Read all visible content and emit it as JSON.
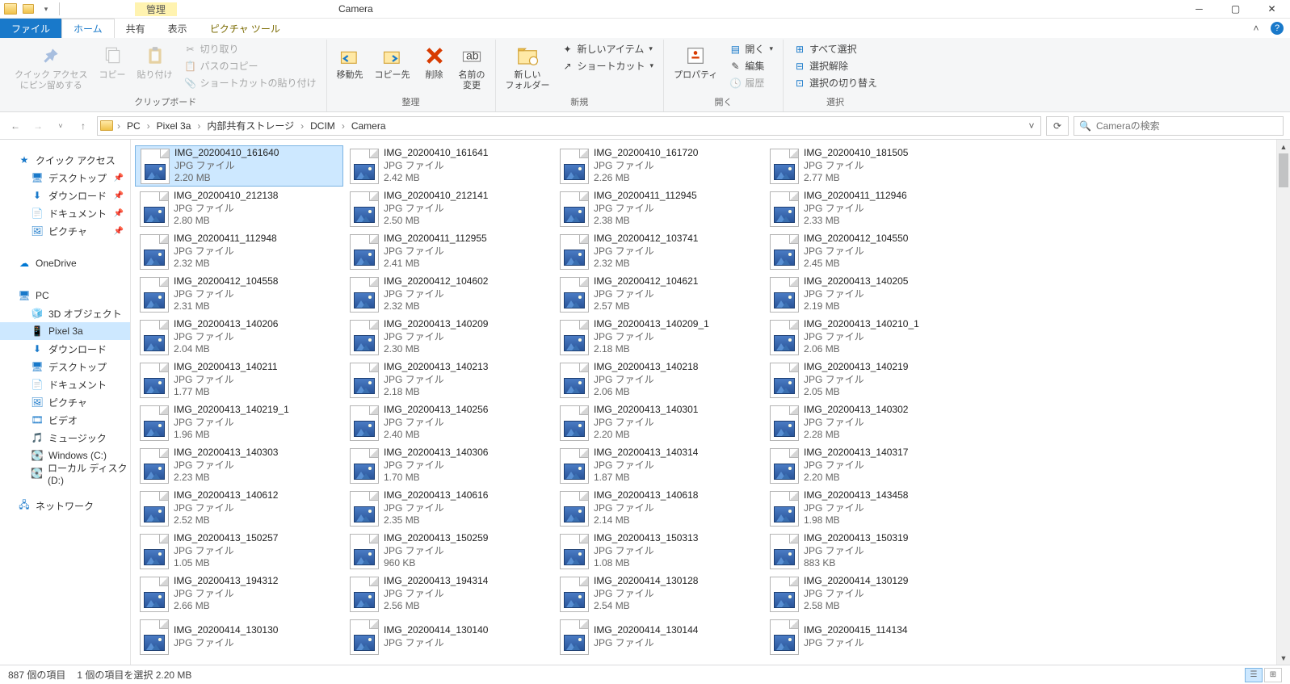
{
  "window": {
    "title": "Camera"
  },
  "ribbon_context": {
    "label": "管理",
    "tab": "ピクチャ ツール"
  },
  "tabs": {
    "file": "ファイル",
    "home": "ホーム",
    "share": "共有",
    "view": "表示"
  },
  "ribbon": {
    "clipboard": {
      "label": "クリップボード",
      "pin": "クイック アクセス\nにピン留めする",
      "copy": "コピー",
      "paste": "貼り付け",
      "cut": "切り取り",
      "copy_path": "パスのコピー",
      "paste_shortcut": "ショートカットの貼り付け"
    },
    "organize": {
      "label": "整理",
      "move_to": "移動先",
      "copy_to": "コピー先",
      "delete": "削除",
      "rename": "名前の\n変更"
    },
    "new": {
      "label": "新規",
      "new_folder": "新しい\nフォルダー",
      "new_item": "新しいアイテム",
      "shortcut": "ショートカット"
    },
    "open": {
      "label": "開く",
      "properties": "プロパティ",
      "open": "開く",
      "edit": "編集",
      "history": "履歴"
    },
    "select": {
      "label": "選択",
      "select_all": "すべて選択",
      "select_none": "選択解除",
      "invert": "選択の切り替え"
    }
  },
  "breadcrumbs": [
    "PC",
    "Pixel 3a",
    "内部共有ストレージ",
    "DCIM",
    "Camera"
  ],
  "search": {
    "placeholder": "Cameraの検索"
  },
  "nav": {
    "quick_access": "クイック アクセス",
    "desktop": "デスクトップ",
    "downloads": "ダウンロード",
    "documents": "ドキュメント",
    "pictures": "ピクチャ",
    "onedrive": "OneDrive",
    "pc": "PC",
    "objects3d": "3D オブジェクト",
    "pixel3a": "Pixel 3a",
    "downloads2": "ダウンロード",
    "desktop2": "デスクトップ",
    "documents2": "ドキュメント",
    "pictures2": "ピクチャ",
    "videos": "ビデオ",
    "music": "ミュージック",
    "windows_c": "Windows (C:)",
    "local_d": "ローカル ディスク (D:)",
    "network": "ネットワーク"
  },
  "file_type_label": "JPG ファイル",
  "files": [
    {
      "name": "IMG_20200410_161640",
      "size": "2.20 MB",
      "sel": true
    },
    {
      "name": "IMG_20200410_161641",
      "size": "2.42 MB"
    },
    {
      "name": "IMG_20200410_161720",
      "size": "2.26 MB"
    },
    {
      "name": "IMG_20200410_181505",
      "size": "2.77 MB"
    },
    {
      "name": "IMG_20200410_212138",
      "size": "2.80 MB"
    },
    {
      "name": "IMG_20200410_212141",
      "size": "2.50 MB"
    },
    {
      "name": "IMG_20200411_112945",
      "size": "2.38 MB"
    },
    {
      "name": "IMG_20200411_112946",
      "size": "2.33 MB"
    },
    {
      "name": "IMG_20200411_112948",
      "size": "2.32 MB"
    },
    {
      "name": "IMG_20200411_112955",
      "size": "2.41 MB"
    },
    {
      "name": "IMG_20200412_103741",
      "size": "2.32 MB"
    },
    {
      "name": "IMG_20200412_104550",
      "size": "2.45 MB"
    },
    {
      "name": "IMG_20200412_104558",
      "size": "2.31 MB"
    },
    {
      "name": "IMG_20200412_104602",
      "size": "2.32 MB"
    },
    {
      "name": "IMG_20200412_104621",
      "size": "2.57 MB"
    },
    {
      "name": "IMG_20200413_140205",
      "size": "2.19 MB"
    },
    {
      "name": "IMG_20200413_140206",
      "size": "2.04 MB"
    },
    {
      "name": "IMG_20200413_140209",
      "size": "2.30 MB"
    },
    {
      "name": "IMG_20200413_140209_1",
      "size": "2.18 MB"
    },
    {
      "name": "IMG_20200413_140210_1",
      "size": "2.06 MB"
    },
    {
      "name": "IMG_20200413_140211",
      "size": "1.77 MB"
    },
    {
      "name": "IMG_20200413_140213",
      "size": "2.18 MB"
    },
    {
      "name": "IMG_20200413_140218",
      "size": "2.06 MB"
    },
    {
      "name": "IMG_20200413_140219",
      "size": "2.05 MB"
    },
    {
      "name": "IMG_20200413_140219_1",
      "size": "1.96 MB"
    },
    {
      "name": "IMG_20200413_140256",
      "size": "2.40 MB"
    },
    {
      "name": "IMG_20200413_140301",
      "size": "2.20 MB"
    },
    {
      "name": "IMG_20200413_140302",
      "size": "2.28 MB"
    },
    {
      "name": "IMG_20200413_140303",
      "size": "2.23 MB"
    },
    {
      "name": "IMG_20200413_140306",
      "size": "1.70 MB"
    },
    {
      "name": "IMG_20200413_140314",
      "size": "1.87 MB"
    },
    {
      "name": "IMG_20200413_140317",
      "size": "2.20 MB"
    },
    {
      "name": "IMG_20200413_140612",
      "size": "2.52 MB"
    },
    {
      "name": "IMG_20200413_140616",
      "size": "2.35 MB"
    },
    {
      "name": "IMG_20200413_140618",
      "size": "2.14 MB"
    },
    {
      "name": "IMG_20200413_143458",
      "size": "1.98 MB"
    },
    {
      "name": "IMG_20200413_150257",
      "size": "1.05 MB"
    },
    {
      "name": "IMG_20200413_150259",
      "size": "960 KB"
    },
    {
      "name": "IMG_20200413_150313",
      "size": "1.08 MB"
    },
    {
      "name": "IMG_20200413_150319",
      "size": "883 KB"
    },
    {
      "name": "IMG_20200413_194312",
      "size": "2.66 MB"
    },
    {
      "name": "IMG_20200413_194314",
      "size": "2.56 MB"
    },
    {
      "name": "IMG_20200414_130128",
      "size": "2.54 MB"
    },
    {
      "name": "IMG_20200414_130129",
      "size": "2.58 MB"
    },
    {
      "name": "IMG_20200414_130130",
      "size": ""
    },
    {
      "name": "IMG_20200414_130140",
      "size": ""
    },
    {
      "name": "IMG_20200414_130144",
      "size": ""
    },
    {
      "name": "IMG_20200415_114134",
      "size": ""
    }
  ],
  "status": {
    "count": "887 個の項目",
    "selection": "1 個の項目を選択 2.20 MB"
  }
}
